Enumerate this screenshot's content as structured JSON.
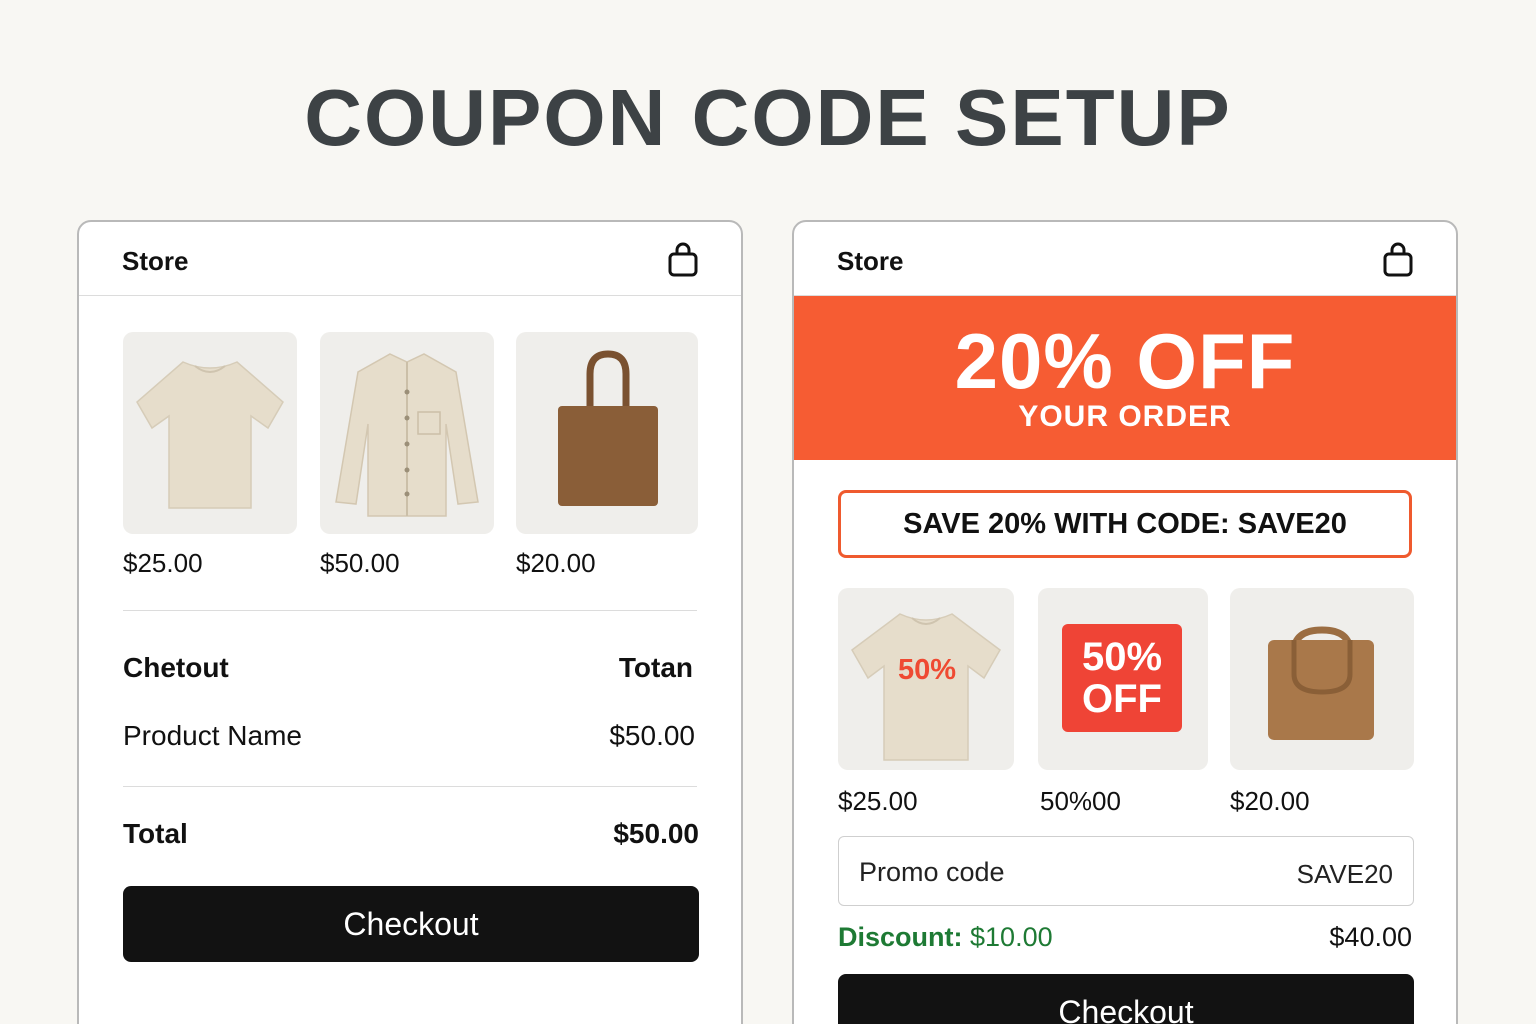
{
  "page_title": "COUPON CODE SETUP",
  "left": {
    "store_title": "Store",
    "products": [
      {
        "name": "t-shirt",
        "price": "$25.00"
      },
      {
        "name": "shirt",
        "price": "$50.00"
      },
      {
        "name": "tote-bag",
        "price": "$20.00"
      }
    ],
    "checkout_heading": "Chetout",
    "total_heading": "Totan",
    "line_item_name": "Product Name",
    "line_item_price": "$50.00",
    "total_label": "Total",
    "total_value": "$50.00",
    "checkout_button": "Checkout"
  },
  "right": {
    "store_title": "Store",
    "banner_big": "20% OFF",
    "banner_small": "YOUR ORDER",
    "code_text": "SAVE 20% WITH CODE: SAVE20",
    "products": [
      {
        "name": "t-shirt",
        "price": "$25.00",
        "badge": "50%"
      },
      {
        "name": "sale-badge",
        "price": "50%00",
        "badge_line1": "50%",
        "badge_line2": "OFF"
      },
      {
        "name": "tote-bag",
        "price": "$20.00"
      }
    ],
    "promo_label": "Promo code",
    "promo_value": "SAVE20",
    "discount_label": "Discount:",
    "discount_value": "$10.00",
    "new_total": "$40.00",
    "checkout_button": "Checkout"
  },
  "colors": {
    "background": "#f8f7f3",
    "title": "#3d4245",
    "banner": "#f65c33",
    "code_border": "#ef5a2e",
    "badge": "#ef4436",
    "discount": "#1e7a34",
    "button": "#121212"
  },
  "icons": [
    "shopping-bag-icon"
  ]
}
